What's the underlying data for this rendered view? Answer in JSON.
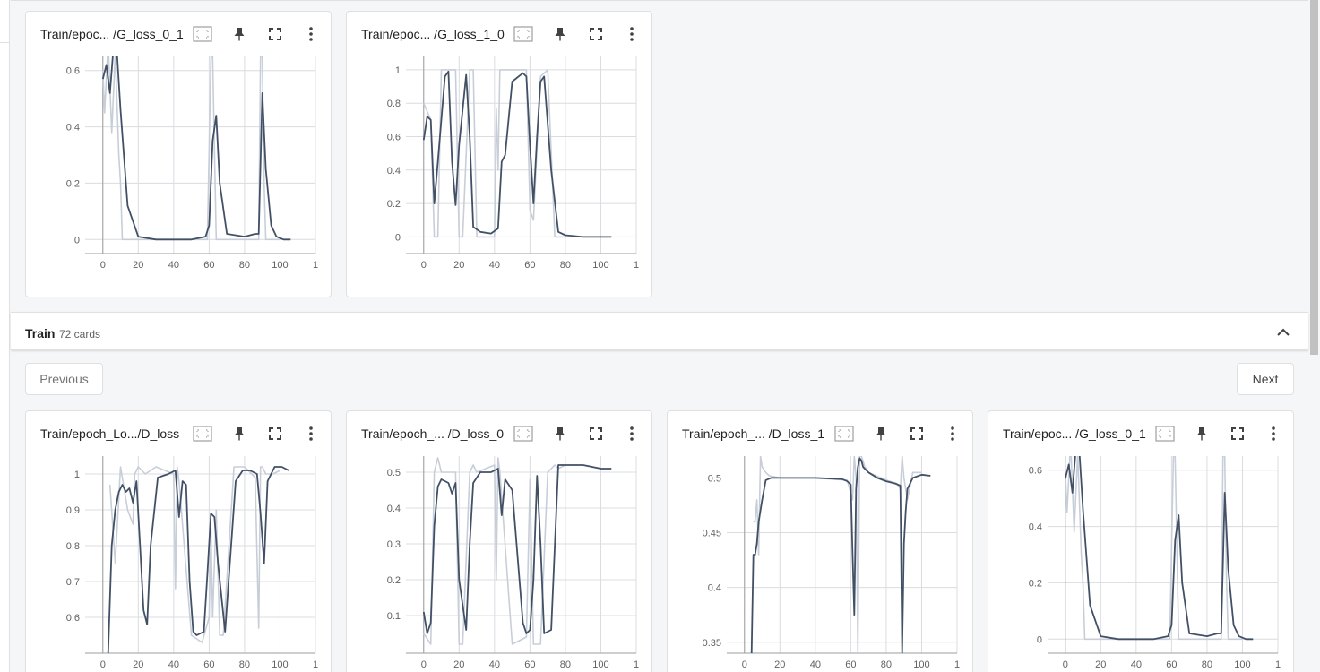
{
  "group": {
    "name": "Train",
    "count_label": "72 cards"
  },
  "pager": {
    "previous_label": "Previous",
    "next_label": "Next"
  },
  "colors": {
    "smoothed": "#425066",
    "raw": "#c8ced8",
    "grid": "#dadce0"
  },
  "icons": [
    "fit-domain-icon",
    "pin-icon",
    "fullscreen-icon",
    "more-vert-icon"
  ],
  "top_cards": [
    {
      "title": "Train/epoc... /G_loss_0_1"
    },
    {
      "title": "Train/epoc... /G_loss_1_0"
    }
  ],
  "bottom_cards": [
    {
      "title": "Train/epoch_Lo.../D_loss"
    },
    {
      "title": "Train/epoch_... /D_loss_0"
    },
    {
      "title": "Train/epoch_... /D_loss_1"
    },
    {
      "title": "Train/epoc... /G_loss_0_1"
    }
  ],
  "chart_data": [
    {
      "type": "line",
      "id": "top-g-loss-0-1",
      "x_ticks": [
        "0",
        "20",
        "40",
        "60",
        "80",
        "100",
        "1"
      ],
      "y_ticks": [
        "0",
        "0.2",
        "0.4",
        "0.6"
      ],
      "ylim": [
        -0.05,
        0.65
      ],
      "series": [
        {
          "x": [
            0,
            2,
            4,
            6,
            8,
            10,
            14,
            20,
            30,
            40,
            50,
            58,
            60,
            62,
            64,
            66,
            70,
            80,
            86,
            88,
            90,
            92,
            95,
            98,
            102,
            106
          ],
          "values": [
            0.57,
            0.62,
            0.52,
            0.68,
            0.66,
            0.46,
            0.12,
            0.01,
            0.0,
            0.0,
            0.0,
            0.01,
            0.05,
            0.35,
            0.44,
            0.2,
            0.02,
            0.01,
            0.02,
            0.02,
            0.52,
            0.25,
            0.05,
            0.01,
            0.0,
            0.0
          ]
        },
        {
          "x": [
            0,
            1,
            3,
            5,
            7,
            9,
            10,
            11,
            30,
            59,
            61,
            62,
            64,
            65,
            66,
            80,
            88,
            89,
            90,
            91,
            92,
            93,
            100
          ],
          "values": [
            0.6,
            0.45,
            0.7,
            0.38,
            0.66,
            0.3,
            0.2,
            0.0,
            0.0,
            0.0,
            0.65,
            0.65,
            0.0,
            0.0,
            0.0,
            0.0,
            0.0,
            0.65,
            0.65,
            0.2,
            0.0,
            0.0,
            0.0
          ]
        }
      ]
    },
    {
      "type": "line",
      "id": "top-g-loss-1-0",
      "x_ticks": [
        "0",
        "20",
        "40",
        "60",
        "80",
        "100",
        "1"
      ],
      "y_ticks": [
        "0",
        "0.2",
        "0.4",
        "0.6",
        "0.8",
        "1"
      ],
      "ylim": [
        -0.1,
        1.08
      ],
      "series": [
        {
          "x": [
            0,
            2,
            4,
            6,
            8,
            12,
            14,
            16,
            18,
            20,
            24,
            26,
            28,
            32,
            38,
            42,
            44,
            46,
            50,
            56,
            58,
            60,
            62,
            64,
            66,
            68,
            72,
            76,
            80,
            90,
            100,
            106
          ],
          "values": [
            0.58,
            0.72,
            0.7,
            0.2,
            0.45,
            0.96,
            0.99,
            0.45,
            0.19,
            0.55,
            0.97,
            0.6,
            0.06,
            0.03,
            0.02,
            0.05,
            0.45,
            0.49,
            0.93,
            0.98,
            0.96,
            0.55,
            0.2,
            0.6,
            0.93,
            0.96,
            0.4,
            0.03,
            0.01,
            0.0,
            0.0,
            0.0
          ]
        },
        {
          "x": [
            0,
            4,
            6,
            8,
            10,
            18,
            20,
            22,
            26,
            28,
            30,
            40,
            41,
            42,
            43,
            50,
            58,
            60,
            62,
            66,
            70,
            74,
            76,
            80
          ],
          "values": [
            0.8,
            0.7,
            0.0,
            0.0,
            1.0,
            1.0,
            0.0,
            0.0,
            1.0,
            1.0,
            0.0,
            0.0,
            0.77,
            0.4,
            1.0,
            1.0,
            1.0,
            0.16,
            0.1,
            0.96,
            1.0,
            0.0,
            0.0,
            0.0
          ]
        }
      ]
    },
    {
      "type": "line",
      "id": "bottom-d-loss",
      "x_ticks": [
        "0",
        "20",
        "40",
        "60",
        "80",
        "100",
        "1"
      ],
      "y_ticks": [
        "0.6",
        "0.7",
        "0.8",
        "0.9",
        "1"
      ],
      "ylim": [
        0.5,
        1.05
      ],
      "series": [
        {
          "x": [
            3,
            5,
            7,
            9,
            11,
            13,
            15,
            17,
            19,
            21,
            23,
            25,
            27,
            31,
            37,
            41,
            43,
            45,
            47,
            49,
            51,
            53,
            57,
            59,
            61,
            63,
            65,
            69,
            71,
            75,
            79,
            83,
            87,
            89,
            91,
            93,
            97,
            101,
            105
          ],
          "values": [
            0.5,
            0.8,
            0.9,
            0.95,
            0.97,
            0.95,
            0.96,
            0.92,
            0.98,
            0.8,
            0.62,
            0.58,
            0.8,
            0.99,
            1.0,
            1.01,
            0.88,
            0.98,
            0.97,
            0.7,
            0.56,
            0.55,
            0.56,
            0.72,
            0.89,
            0.88,
            0.75,
            0.56,
            0.7,
            0.98,
            1.01,
            1.01,
            1.0,
            0.89,
            0.75,
            0.98,
            1.02,
            1.02,
            1.01
          ]
        },
        {
          "x": [
            4,
            7,
            10,
            14,
            17,
            18,
            20,
            24,
            30,
            40,
            41,
            42,
            43,
            50,
            56,
            60,
            61,
            62,
            64,
            66,
            68,
            74,
            80,
            86,
            88,
            89,
            90,
            91,
            92,
            96,
            100
          ],
          "values": [
            0.97,
            0.75,
            1.02,
            0.9,
            0.86,
            1.0,
            1.02,
            1.0,
            1.02,
            1.0,
            0.68,
            1.02,
            0.98,
            0.55,
            0.53,
            0.6,
            0.85,
            0.6,
            0.9,
            0.55,
            0.55,
            1.02,
            1.02,
            0.99,
            0.57,
            1.02,
            1.02,
            1.01,
            1.0,
            1.0,
            1.01
          ]
        }
      ]
    },
    {
      "type": "line",
      "id": "bottom-d-loss-0",
      "x_ticks": [
        "0",
        "20",
        "40",
        "60",
        "80",
        "100",
        "1"
      ],
      "y_ticks": [
        "0.1",
        "0.2",
        "0.3",
        "0.4",
        "0.5"
      ],
      "ylim": [
        -0.005,
        0.545
      ],
      "series": [
        {
          "x": [
            0,
            2,
            4,
            6,
            8,
            10,
            14,
            16,
            18,
            20,
            24,
            26,
            28,
            32,
            38,
            42,
            44,
            46,
            50,
            56,
            58,
            60,
            62,
            64,
            66,
            68,
            72,
            76,
            80,
            90,
            100,
            106
          ],
          "values": [
            0.11,
            0.05,
            0.08,
            0.35,
            0.46,
            0.48,
            0.47,
            0.44,
            0.47,
            0.2,
            0.06,
            0.3,
            0.47,
            0.5,
            0.5,
            0.51,
            0.38,
            0.48,
            0.45,
            0.08,
            0.05,
            0.06,
            0.2,
            0.49,
            0.3,
            0.05,
            0.06,
            0.52,
            0.52,
            0.52,
            0.51,
            0.51
          ]
        },
        {
          "x": [
            0,
            4,
            6,
            8,
            10,
            18,
            20,
            22,
            26,
            28,
            30,
            40,
            41,
            42,
            43,
            50,
            58,
            60,
            62,
            66,
            70,
            74,
            76,
            80
          ],
          "values": [
            0.05,
            0.02,
            0.5,
            0.54,
            0.5,
            0.5,
            0.02,
            0.02,
            0.5,
            0.52,
            0.5,
            0.52,
            0.2,
            0.54,
            0.5,
            0.02,
            0.04,
            0.48,
            0.02,
            0.02,
            0.5,
            0.52,
            0.51,
            0.52
          ]
        }
      ]
    },
    {
      "type": "line",
      "id": "bottom-d-loss-1",
      "x_ticks": [
        "0",
        "20",
        "40",
        "60",
        "80",
        "100",
        "1"
      ],
      "y_ticks": [
        "0.35",
        "0.4",
        "0.45",
        "0.5"
      ],
      "ylim": [
        0.34,
        0.52
      ],
      "series": [
        {
          "x": [
            4,
            5,
            6,
            7,
            8,
            10,
            12,
            15,
            20,
            40,
            55,
            58,
            60,
            61,
            62,
            63,
            64,
            65,
            66,
            67,
            70,
            75,
            80,
            85,
            88,
            89,
            90,
            91,
            92,
            95,
            100,
            105
          ],
          "values": [
            0.34,
            0.43,
            0.43,
            0.44,
            0.46,
            0.48,
            0.498,
            0.5,
            0.5,
            0.5,
            0.499,
            0.497,
            0.494,
            0.43,
            0.375,
            0.49,
            0.51,
            0.518,
            0.516,
            0.51,
            0.505,
            0.5,
            0.497,
            0.495,
            0.493,
            0.34,
            0.44,
            0.47,
            0.49,
            0.5,
            0.503,
            0.502
          ]
        },
        {
          "x": [
            5,
            6,
            7,
            8,
            9,
            10,
            12,
            14,
            20,
            40,
            58,
            61,
            62,
            63,
            64,
            65,
            66,
            68,
            70,
            80,
            86,
            88,
            89,
            90,
            92,
            95,
            100
          ],
          "values": [
            0.46,
            0.46,
            0.48,
            0.43,
            0.52,
            0.51,
            0.505,
            0.502,
            0.5,
            0.5,
            0.498,
            0.48,
            0.52,
            0.5,
            0.34,
            0.52,
            0.52,
            0.51,
            0.505,
            0.498,
            0.495,
            0.49,
            0.52,
            0.5,
            0.48,
            0.505,
            0.505
          ]
        }
      ]
    },
    {
      "type": "line",
      "id": "bottom-g-loss-0-1",
      "x_ticks": [
        "0",
        "20",
        "40",
        "60",
        "80",
        "100",
        "1"
      ],
      "y_ticks": [
        "0",
        "0.2",
        "0.4",
        "0.6"
      ],
      "ylim": [
        -0.05,
        0.65
      ],
      "series": [
        {
          "x": [
            0,
            2,
            4,
            6,
            8,
            10,
            14,
            20,
            30,
            40,
            50,
            58,
            60,
            62,
            64,
            66,
            70,
            80,
            86,
            88,
            90,
            92,
            95,
            98,
            102,
            106
          ],
          "values": [
            0.57,
            0.62,
            0.52,
            0.68,
            0.66,
            0.46,
            0.12,
            0.01,
            0.0,
            0.0,
            0.0,
            0.01,
            0.05,
            0.35,
            0.44,
            0.2,
            0.02,
            0.01,
            0.02,
            0.02,
            0.52,
            0.25,
            0.05,
            0.01,
            0.0,
            0.0
          ]
        },
        {
          "x": [
            0,
            1,
            3,
            5,
            7,
            9,
            10,
            11,
            30,
            59,
            61,
            62,
            64,
            65,
            66,
            80,
            88,
            89,
            90,
            91,
            92,
            93,
            100
          ],
          "values": [
            0.6,
            0.45,
            0.7,
            0.38,
            0.66,
            0.3,
            0.2,
            0.0,
            0.0,
            0.0,
            0.65,
            0.65,
            0.0,
            0.0,
            0.0,
            0.0,
            0.0,
            0.65,
            0.65,
            0.2,
            0.0,
            0.0,
            0.0
          ]
        }
      ]
    }
  ]
}
